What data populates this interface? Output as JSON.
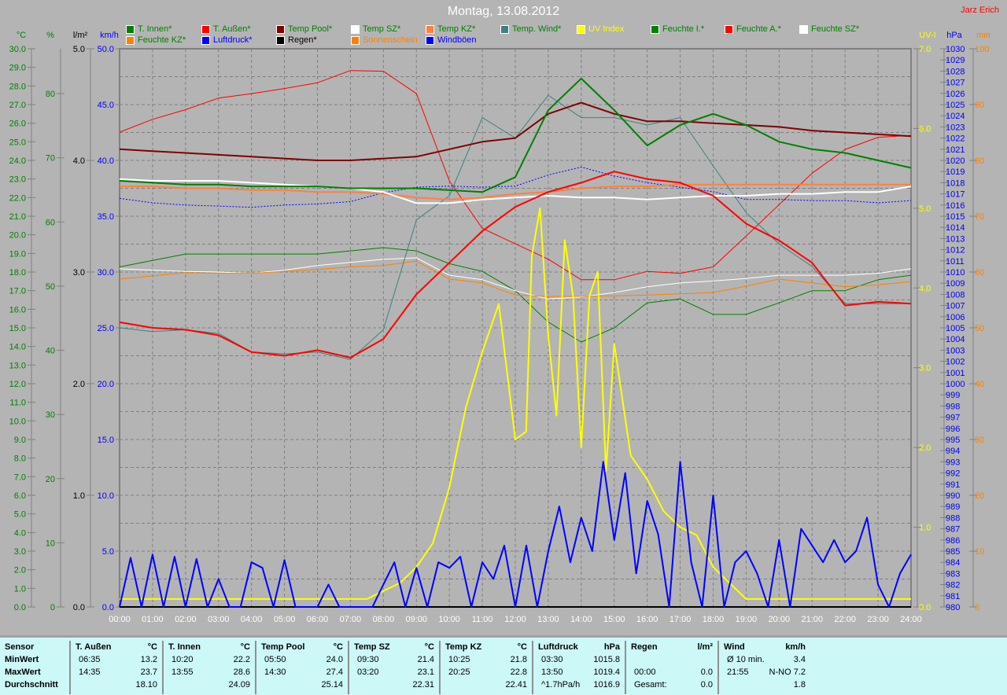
{
  "title": "Montag, 13.08.2012",
  "author": "Jarz Erich",
  "legend": [
    {
      "label": "T. Innen*",
      "color": "#008000",
      "text": "#008000"
    },
    {
      "label": "T. Außen*",
      "color": "#ff0000",
      "text": "#008000"
    },
    {
      "label": "Temp Pool*",
      "color": "#800000",
      "text": "#008000"
    },
    {
      "label": "Temp SZ*",
      "color": "#ffffff",
      "text": "#008000"
    },
    {
      "label": "Temp KZ*",
      "color": "#ff8040",
      "text": "#008000"
    },
    {
      "label": "Temp. Wind*",
      "color": "#408080",
      "text": "#008000"
    },
    {
      "label": "UV Index",
      "color": "#ffff00",
      "text": "#ffff00"
    },
    {
      "label": "Feuchte I.*",
      "color": "#008000",
      "text": "#008000"
    },
    {
      "label": "Feuchte A.*",
      "color": "#ff0000",
      "text": "#008000"
    },
    {
      "label": "Feuchte SZ*",
      "color": "#ffffff",
      "text": "#008000"
    },
    {
      "label": "Feuchte KZ*",
      "color": "#ff8000",
      "text": "#008000"
    },
    {
      "label": "Luftdruck*",
      "color": "#0000ff",
      "text": "#0000ff"
    },
    {
      "label": "Regen*",
      "color": "#000000",
      "text": "#000000"
    },
    {
      "label": "Sonnenschein",
      "color": "#ff8000",
      "text": "#ff8000"
    },
    {
      "label": "Windböen",
      "color": "#0000ff",
      "text": "#0000ff"
    }
  ],
  "chart_data": {
    "type": "line",
    "title": "Montag, 13.08.2012",
    "x_ticks": [
      "00:00",
      "01:00",
      "02:00",
      "03:00",
      "04:00",
      "05:00",
      "06:00",
      "07:00",
      "08:00",
      "09:00",
      "10:00",
      "11:00",
      "12:00",
      "13:00",
      "14:00",
      "15:00",
      "16:00",
      "17:00",
      "18:00",
      "19:00",
      "20:00",
      "21:00",
      "22:00",
      "23:00",
      "24:00"
    ],
    "axes": {
      "temp": {
        "label": "°C",
        "min": 0,
        "max": 30,
        "step": 1,
        "color": "#008000",
        "side": "left"
      },
      "hum": {
        "label": "%",
        "min": 0,
        "max": 87,
        "step": 10,
        "color": "#008000",
        "side": "left"
      },
      "rain": {
        "label": "l/m²",
        "min": 0,
        "max": 5,
        "step": 1,
        "color": "#000000",
        "side": "left"
      },
      "wind": {
        "label": "km/h",
        "min": 0,
        "max": 50,
        "step": 5,
        "color": "#0000ff",
        "side": "left"
      },
      "uv": {
        "label": "UV-I",
        "min": 0,
        "max": 7,
        "step": 1,
        "color": "#ffff00",
        "side": "right"
      },
      "press": {
        "label": "hPa",
        "min": 980,
        "max": 1030,
        "step": 1,
        "color": "#0000ff",
        "side": "right"
      },
      "sun": {
        "label": "min",
        "min": 0,
        "max": 100,
        "step": 10,
        "color": "#ff8000",
        "side": "right"
      }
    },
    "series": [
      {
        "name": "Feuchte A.",
        "axis": "hum",
        "color": "#ff0000",
        "width": 1,
        "values": [
          74,
          76,
          77.5,
          79.3,
          80,
          80.8,
          81.7,
          83.6,
          83.5,
          80,
          66.4,
          59,
          56.6,
          54.2,
          51,
          51,
          52.3,
          52,
          53,
          57.8,
          62.7,
          67.6,
          71.3,
          73.2,
          73.5
        ]
      },
      {
        "name": "Feuchte I.",
        "axis": "hum",
        "color": "#008000",
        "width": 1,
        "values": [
          53,
          54,
          55,
          55,
          55,
          55,
          55,
          55.5,
          56,
          55.5,
          53.5,
          52.3,
          49.3,
          44.4,
          41.3,
          43.5,
          47.4,
          48,
          45.6,
          45.6,
          47.4,
          49.3,
          49.3,
          51,
          51.7
        ]
      },
      {
        "name": "Feuchte SZ",
        "axis": "hum",
        "color": "#ffffff",
        "width": 1,
        "values": [
          52.7,
          52.5,
          52.3,
          52.2,
          52,
          52.5,
          53.2,
          53.7,
          54.2,
          54.4,
          51.7,
          51,
          49.3,
          48,
          48.3,
          49,
          49.9,
          50.5,
          50.8,
          51.2,
          51.7,
          51.7,
          51.7,
          52,
          52.7
        ]
      },
      {
        "name": "Feuchte KZ",
        "axis": "hum",
        "color": "#ff8000",
        "width": 1,
        "values": [
          51.1,
          51.6,
          52.1,
          52,
          52,
          52.3,
          52.6,
          53,
          53.2,
          53.9,
          51.1,
          50.5,
          48.6,
          48.4,
          48.4,
          48.5,
          48.6,
          48.8,
          49,
          50,
          51.1,
          50.5,
          49.9,
          50.2,
          50.7
        ]
      },
      {
        "name": "Luftdruck",
        "axis": "press",
        "color": "#0000ff",
        "width": 1,
        "dash": "2,2",
        "values": [
          1016.6,
          1016.2,
          1016,
          1015.9,
          1015.8,
          1016,
          1016.1,
          1016.3,
          1017.1,
          1017.6,
          1017.7,
          1017.6,
          1017.7,
          1018.7,
          1019.4,
          1018.6,
          1018,
          1017.6,
          1017.2,
          1016.5,
          1016.5,
          1016.4,
          1016.4,
          1016.2,
          1016.4
        ]
      },
      {
        "name": "Temp. Wind",
        "axis": "temp",
        "color": "#408080",
        "width": 1,
        "values": [
          15,
          14.8,
          14.9,
          14.7,
          13.7,
          13.6,
          13.7,
          13.3,
          14.9,
          20.8,
          22.1,
          26.3,
          25.2,
          27.5,
          26.3,
          26.3,
          25.9,
          26.3,
          23.7,
          21.2,
          19.5,
          18.3,
          16.3,
          16.3,
          16.3
        ]
      },
      {
        "name": "Temp KZ",
        "axis": "temp",
        "color": "#ff8040",
        "width": 2,
        "values": [
          22.6,
          22.6,
          22.5,
          22.5,
          22.4,
          22.4,
          22.3,
          22.3,
          22.2,
          22,
          21.9,
          22,
          22.2,
          22.3,
          22.5,
          22.6,
          22.6,
          22.7,
          22.7,
          22.7,
          22.7,
          22.7,
          22.7,
          22.7,
          22.7
        ]
      },
      {
        "name": "Temp SZ",
        "axis": "temp",
        "color": "#ffffff",
        "width": 2,
        "values": [
          23,
          22.9,
          22.9,
          22.9,
          22.8,
          22.7,
          22.6,
          22.5,
          22.3,
          21.7,
          21.7,
          21.9,
          22,
          22.1,
          22,
          22,
          21.9,
          22,
          22.1,
          22.1,
          22.2,
          22.2,
          22.3,
          22.3,
          22.6
        ]
      },
      {
        "name": "Temp Pool",
        "axis": "temp",
        "color": "#800000",
        "width": 2,
        "values": [
          24.6,
          24.5,
          24.4,
          24.3,
          24.2,
          24.1,
          24,
          24,
          24.1,
          24.2,
          24.6,
          25,
          25.2,
          26.5,
          27.1,
          26.5,
          26.1,
          26.1,
          26,
          25.9,
          25.8,
          25.6,
          25.5,
          25.4,
          25.3
        ]
      },
      {
        "name": "T. Innen",
        "axis": "temp",
        "color": "#008000",
        "width": 2,
        "values": [
          22.9,
          22.8,
          22.7,
          22.7,
          22.6,
          22.6,
          22.6,
          22.5,
          22.5,
          22.5,
          22.4,
          22.3,
          23.1,
          26.7,
          28.4,
          26.7,
          24.8,
          25.9,
          26.5,
          25.9,
          25,
          24.6,
          24.4,
          24,
          23.6
        ]
      },
      {
        "name": "T. Außen",
        "axis": "temp",
        "color": "#ff0000",
        "width": 2,
        "values": [
          15.3,
          15,
          14.9,
          14.6,
          13.7,
          13.5,
          13.8,
          13.4,
          14.4,
          16.8,
          18.5,
          20.2,
          21.5,
          22.3,
          22.8,
          23.4,
          23,
          22.8,
          22.1,
          20.6,
          19.7,
          18.5,
          16.2,
          16.4,
          16.3
        ]
      },
      {
        "name": "UV Index",
        "axis": "uv",
        "color": "#ffff00",
        "width": 2,
        "x": [
          0,
          7.5,
          8,
          8.5,
          9,
          9.5,
          10,
          10.5,
          11,
          11.5,
          12,
          12.33,
          12.5,
          12.75,
          13,
          13.25,
          13.5,
          13.75,
          14,
          14.25,
          14.5,
          14.75,
          15,
          15.25,
          15.5,
          16,
          16.5,
          17,
          17.5,
          18,
          18.5,
          19,
          24
        ],
        "values": [
          0.1,
          0.1,
          0.2,
          0.3,
          0.5,
          0.8,
          1.5,
          2.5,
          3.2,
          3.8,
          2.1,
          2.2,
          4.4,
          5,
          3.4,
          2.4,
          4.6,
          3.9,
          2,
          3.9,
          4.2,
          1.7,
          3.3,
          2.6,
          1.9,
          1.6,
          1.2,
          1,
          0.9,
          0.5,
          0.3,
          0.1,
          0.1
        ]
      },
      {
        "name": "Windböen",
        "axis": "wind",
        "color": "#0000ff",
        "width": 2,
        "step_minutes": 20,
        "values": [
          0,
          4.4,
          0,
          4.7,
          0,
          4.5,
          0,
          4.3,
          0,
          2.5,
          0,
          0,
          4,
          3.5,
          0,
          4.2,
          0,
          0,
          0,
          2,
          0,
          0,
          0,
          0,
          2,
          4,
          0,
          3.5,
          0,
          4,
          3.5,
          4.5,
          0,
          4,
          2.5,
          5.5,
          0,
          5.5,
          0,
          5,
          9,
          4,
          8,
          5,
          13,
          6,
          12,
          3,
          9.5,
          6.5,
          0,
          13,
          4,
          0,
          10,
          0,
          4,
          5,
          3,
          0,
          6,
          0,
          7,
          5.5,
          4,
          6,
          4,
          5,
          8,
          2,
          0,
          3,
          4.7
        ]
      }
    ]
  },
  "table": {
    "columns": [
      {
        "head": "Sensor",
        "unit": "",
        "rows": [
          {
            "a": "MinWert",
            "b": ""
          },
          {
            "a": "MaxWert",
            "b": ""
          },
          {
            "a": "Durchschnitt",
            "b": ""
          }
        ],
        "bold": true
      },
      {
        "head": "T. Außen",
        "unit": "°C",
        "rows": [
          {
            "a": "06:35",
            "b": "13.2"
          },
          {
            "a": "14:35",
            "b": "23.7"
          },
          {
            "a": "",
            "b": "18.10"
          }
        ]
      },
      {
        "head": "T. Innen",
        "unit": "°C",
        "rows": [
          {
            "a": "10:20",
            "b": "22.2"
          },
          {
            "a": "13:55",
            "b": "28.6"
          },
          {
            "a": "",
            "b": "24.09"
          }
        ]
      },
      {
        "head": "Temp Pool",
        "unit": "°C",
        "rows": [
          {
            "a": "05:50",
            "b": "24.0"
          },
          {
            "a": "14:30",
            "b": "27.4"
          },
          {
            "a": "",
            "b": "25.14"
          }
        ]
      },
      {
        "head": "Temp SZ",
        "unit": "°C",
        "rows": [
          {
            "a": "09:30",
            "b": "21.4"
          },
          {
            "a": "03:20",
            "b": "23.1"
          },
          {
            "a": "",
            "b": "22.31"
          }
        ]
      },
      {
        "head": "Temp KZ",
        "unit": "°C",
        "rows": [
          {
            "a": "10:25",
            "b": "21.8"
          },
          {
            "a": "20:25",
            "b": "22.8"
          },
          {
            "a": "",
            "b": "22.41"
          }
        ]
      },
      {
        "head": "Luftdruck",
        "unit": "hPa",
        "rows": [
          {
            "a": "03:30",
            "b": "1015.8"
          },
          {
            "a": "13:50",
            "b": "1019.4"
          },
          {
            "a": "^1.7hPa/h",
            "b": "1016.9"
          }
        ]
      },
      {
        "head": "Regen",
        "unit": "l/m²",
        "rows": [
          {
            "a": "",
            "b": ""
          },
          {
            "a": "00:00",
            "b": "0.0"
          },
          {
            "a": "Gesamt:",
            "b": "0.0"
          }
        ]
      },
      {
        "head": "Wind",
        "unit": "km/h",
        "rows": [
          {
            "a": "Ø 10 min.",
            "b": "3.4"
          },
          {
            "a": "21:55",
            "b": "N-NO 7.2"
          },
          {
            "a": "",
            "b": "1.8"
          }
        ]
      }
    ]
  }
}
